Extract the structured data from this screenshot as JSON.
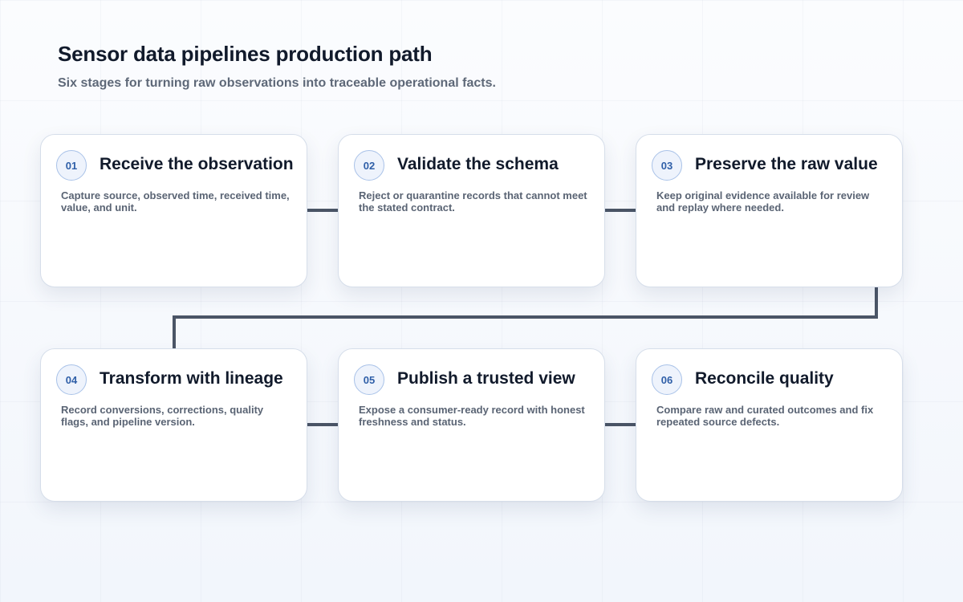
{
  "header": {
    "title": "Sensor data pipelines production path",
    "subtitle": "Six stages for turning raw observations into traceable operational facts."
  },
  "stages": [
    {
      "number": "01",
      "title": "Receive the observation",
      "description": "Capture source, observed time, received time, value, and unit."
    },
    {
      "number": "02",
      "title": "Validate the schema",
      "description": "Reject or quarantine records that cannot meet the stated contract."
    },
    {
      "number": "03",
      "title": "Preserve the raw value",
      "description": "Keep original evidence available for review and replay where needed."
    },
    {
      "number": "04",
      "title": "Transform with lineage",
      "description": "Record conversions, corrections, quality flags, and pipeline version."
    },
    {
      "number": "05",
      "title": "Publish a trusted view",
      "description": "Expose a consumer-ready record with honest freshness and status."
    },
    {
      "number": "06",
      "title": "Reconcile quality",
      "description": "Compare raw and curated outcomes and fix repeated source defects."
    }
  ],
  "colors": {
    "connector": "#4b5566",
    "badge_text": "#2f5fa8",
    "title_text": "#111a2b",
    "description_text": "#5a6474"
  }
}
